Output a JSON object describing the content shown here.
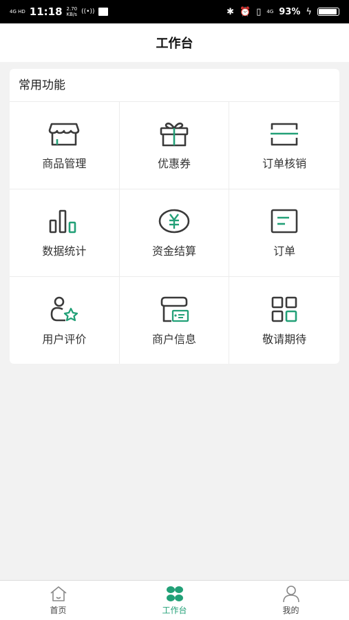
{
  "status_bar": {
    "network": "4G HD",
    "time": "11:18",
    "speed_value": "2.70",
    "speed_unit": "KB/s",
    "signal_small": "4G",
    "battery": "93%"
  },
  "header": {
    "title": "工作台"
  },
  "card": {
    "title": "常用功能",
    "items": [
      {
        "label": "商品管理",
        "icon": "shop-icon"
      },
      {
        "label": "优惠券",
        "icon": "gift-icon"
      },
      {
        "label": "订单核销",
        "icon": "scan-icon"
      },
      {
        "label": "数据统计",
        "icon": "bar-chart-icon"
      },
      {
        "label": "资金结算",
        "icon": "yuan-icon"
      },
      {
        "label": "订单",
        "icon": "order-icon"
      },
      {
        "label": "用户评价",
        "icon": "user-star-icon"
      },
      {
        "label": "商户信息",
        "icon": "merchant-icon"
      },
      {
        "label": "敬请期待",
        "icon": "grid-icon"
      }
    ]
  },
  "tabbar": {
    "items": [
      {
        "label": "首页",
        "icon": "home-icon"
      },
      {
        "label": "工作台",
        "icon": "workbench-icon",
        "active": true
      },
      {
        "label": "我的",
        "icon": "profile-icon"
      }
    ]
  },
  "colors": {
    "accent": "#22a077",
    "icon_dark": "#3a3a3a"
  }
}
